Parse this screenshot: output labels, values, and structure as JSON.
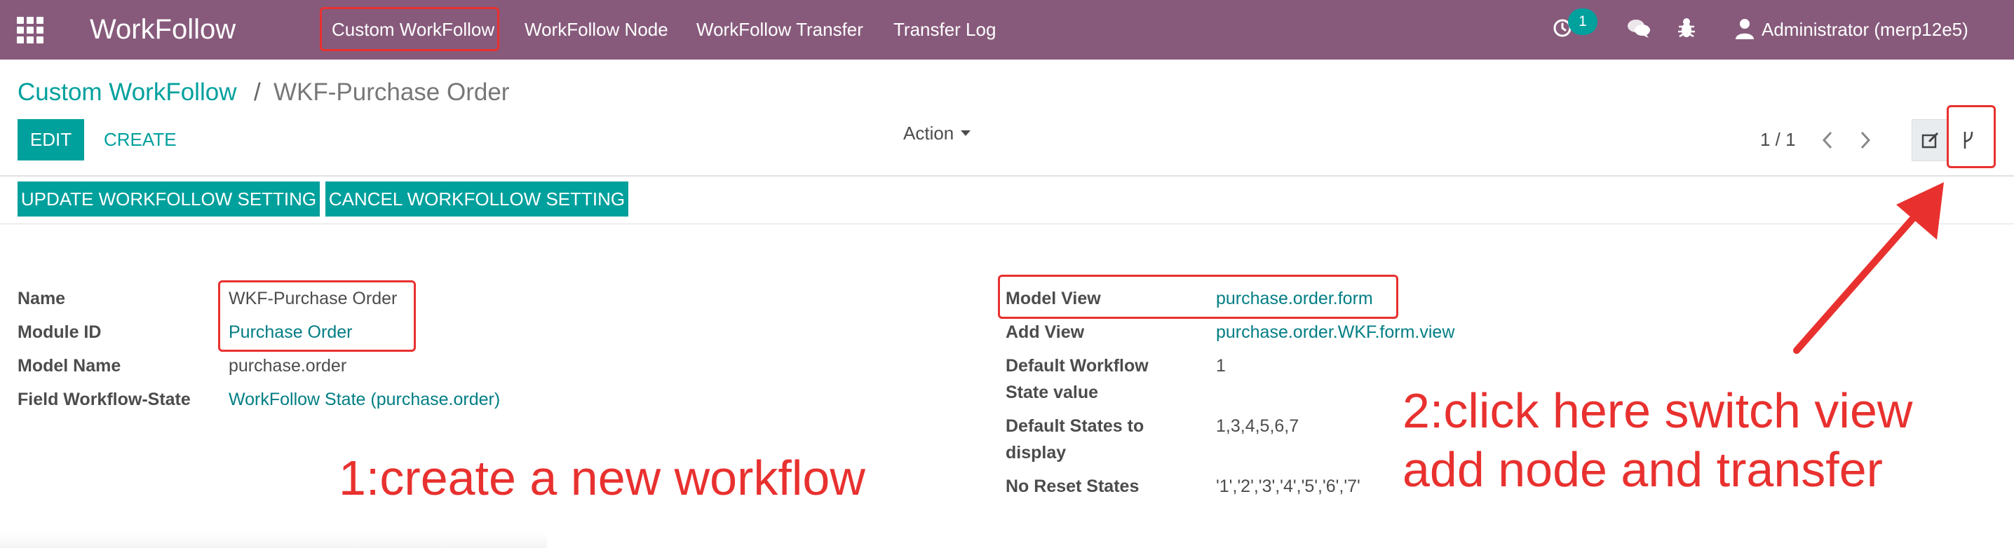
{
  "navbar": {
    "brand": "WorkFollow",
    "menu": [
      "Custom WorkFollow",
      "WorkFollow Node",
      "WorkFollow Transfer",
      "Transfer Log"
    ],
    "activity_count": "1",
    "user": "Administrator (merp12e5)"
  },
  "breadcrumb": {
    "parent": "Custom WorkFollow",
    "separator": "/",
    "current": "WKF-Purchase Order"
  },
  "buttons": {
    "edit": "EDIT",
    "create": "CREATE",
    "action": "Action"
  },
  "pager": {
    "value": "1 / 1"
  },
  "header_buttons": [
    "UPDATE WORKFOLLOW SETTING",
    "CANCEL WORKFOLLOW SETTING"
  ],
  "form": {
    "left": [
      {
        "label": "Name",
        "value": "WKF-Purchase Order"
      },
      {
        "label": "Module ID",
        "value": "Purchase Order"
      },
      {
        "label": "Model Name",
        "value": "purchase.order"
      },
      {
        "label": "Field Workflow-State",
        "value": "WorkFollow State (purchase.order)"
      }
    ],
    "right": [
      {
        "label": "Model View",
        "value": "purchase.order.form"
      },
      {
        "label": "Add View",
        "value": "purchase.order.WKF.form.view"
      },
      {
        "label_line1": "Default Workflow",
        "label_line2": "State value",
        "value": "1"
      },
      {
        "label_line1": "Default States to",
        "label_line2": "display",
        "value": "1,3,4,5,6,7"
      },
      {
        "label": "No Reset States",
        "value": "'1','2','3','4','5','6','7'"
      }
    ]
  },
  "annotations": {
    "note1": "1:create a new workflow",
    "note2_line1": "2:click here switch view",
    "note2_line2": "add node and transfer"
  },
  "colors": {
    "navbar": "#875a7b",
    "accent": "#00a09d",
    "link": "#017e84",
    "annotation": "#e8312f"
  },
  "icons": [
    "apps-grid-icon",
    "clock-icon",
    "chat-icon",
    "bug-icon",
    "user-icon",
    "chevron-left-icon",
    "chevron-right-icon",
    "edit-form-icon",
    "diagram-icon",
    "caret-down-icon",
    "arrow-icon"
  ]
}
